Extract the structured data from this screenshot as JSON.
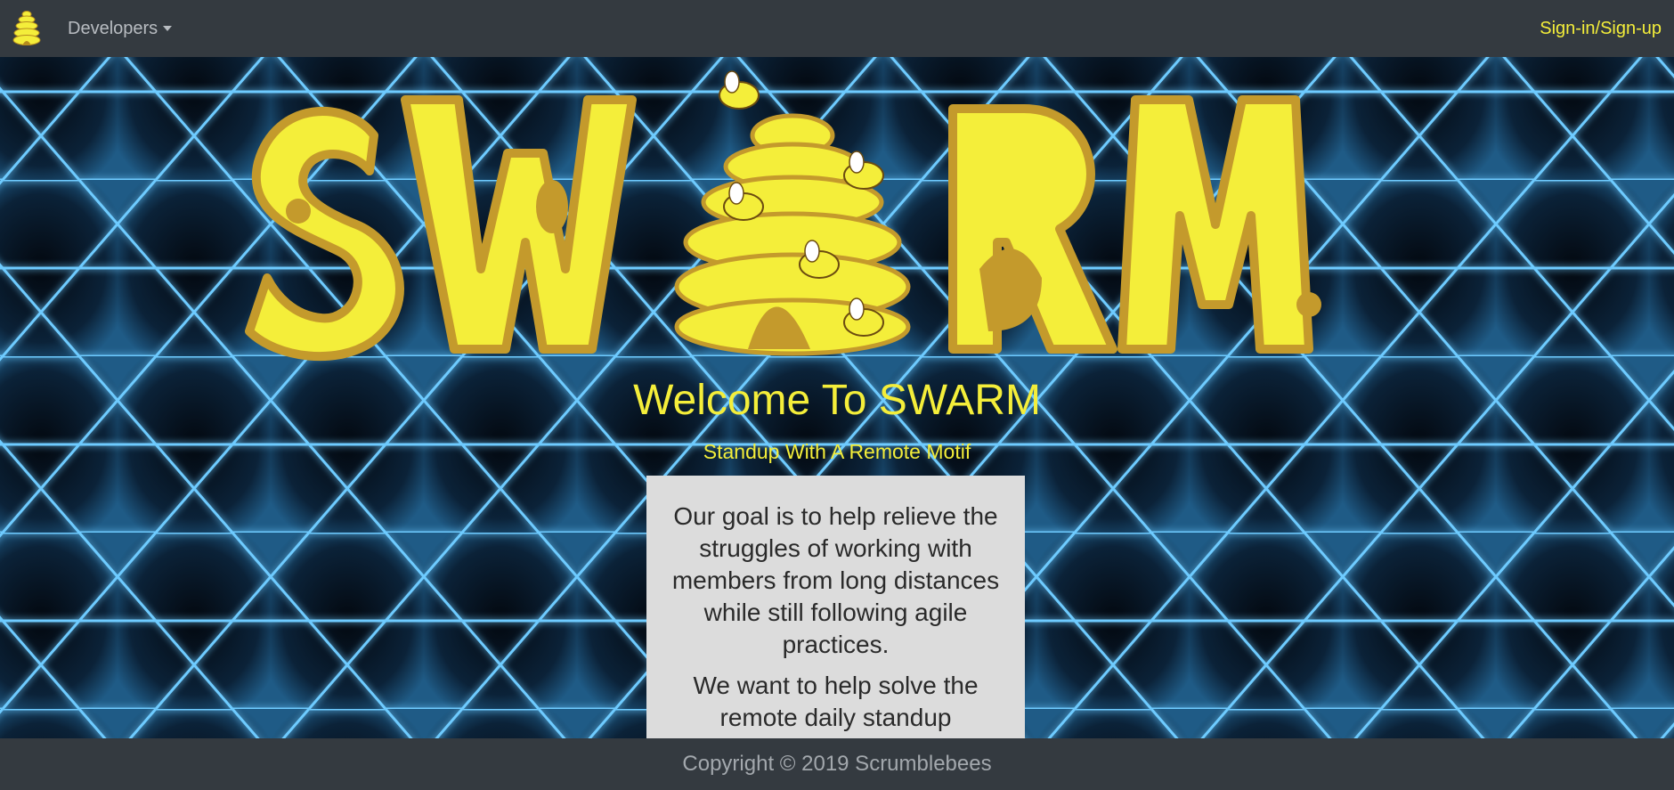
{
  "nav": {
    "brand_icon": "beehive-logo-icon",
    "developers_label": "Developers",
    "signin_label": "Sign-in/Sign-up"
  },
  "hero": {
    "logo_text": "SWARM",
    "welcome_title": "Welcome To SWARM",
    "tagline": "Standup With A Remote Motif"
  },
  "card": {
    "paragraph1": "Our goal is to help relieve the struggles of working with members from long distances while still following agile practices.",
    "paragraph2": "We want to help solve the remote daily standup"
  },
  "footer": {
    "copyright": "Copyright © 2019 Scrumblebees"
  },
  "colors": {
    "navbar": "#343a40",
    "accent_yellow": "#f4ee3a",
    "logo_gold": "#c49a2c",
    "hex_glow": "#5ec7ff"
  }
}
